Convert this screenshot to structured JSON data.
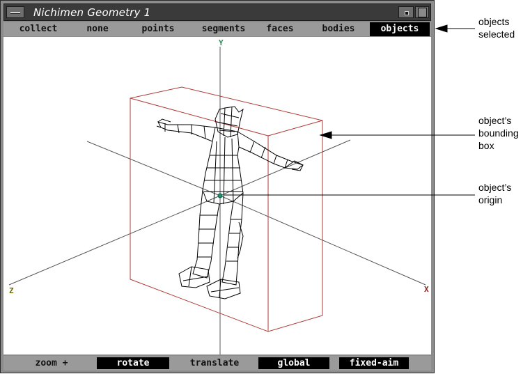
{
  "window": {
    "title": "Nichimen Geometry 1"
  },
  "menubar": {
    "items": [
      {
        "label": "collect",
        "selected": false
      },
      {
        "label": "none",
        "selected": false
      },
      {
        "label": "points",
        "selected": false
      },
      {
        "label": "segments",
        "selected": false
      },
      {
        "label": "faces",
        "selected": false
      },
      {
        "label": "bodies",
        "selected": false
      },
      {
        "label": "objects",
        "selected": true
      }
    ]
  },
  "viewport": {
    "axis_labels": {
      "y": "Y",
      "x": "X",
      "z": "Z"
    },
    "colors": {
      "y_label": "#2e8b57",
      "x_label": "#8b1a1a",
      "z_label": "#6b6b00",
      "bounding_box": "#b03a3a",
      "axes": "#555555",
      "origin_marker": "#1f8f6f"
    }
  },
  "bottombar": {
    "buttons": [
      {
        "label": "zoom +",
        "dark": false
      },
      {
        "label": "rotate",
        "dark": true
      },
      {
        "label": "translate",
        "dark": false
      },
      {
        "label": "global",
        "dark": true
      },
      {
        "label": "fixed-aim",
        "dark": true
      }
    ]
  },
  "annotations": {
    "selected": [
      "objects",
      "selected"
    ],
    "bounding_box": [
      "object’s",
      "bounding",
      "box"
    ],
    "origin": [
      "object’s",
      "origin"
    ]
  }
}
